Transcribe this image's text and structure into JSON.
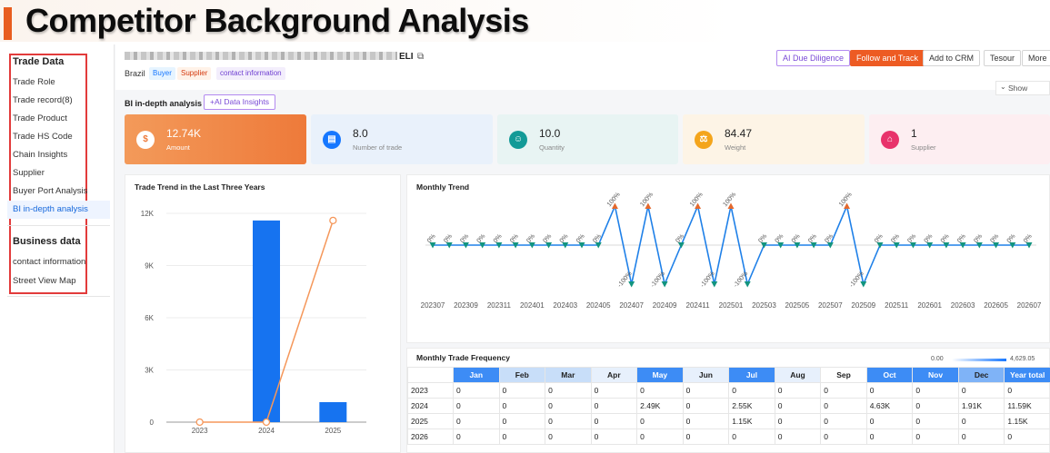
{
  "banner": {
    "title": "Competitor Background Analysis"
  },
  "sidebar": {
    "trade_section": "Trade Data",
    "trade_items": [
      "Trade Role",
      "Trade record(8)",
      "Trade Product",
      "Trade HS Code",
      "Chain Insights",
      "Supplier",
      "Buyer Port Analysis",
      "BI in-depth analysis"
    ],
    "business_section": "Business data",
    "business_items": [
      "contact information",
      "Street View Map"
    ]
  },
  "header": {
    "company_name": "ELI",
    "country": "Brazil",
    "tags": {
      "buyer": "Buyer",
      "supplier": "Supplier",
      "contact": "contact information"
    },
    "buttons": {
      "ai": "AI Due Diligence",
      "follow": "Follow and Track",
      "crm": "Add to CRM",
      "tesour": "Tesour",
      "more": "More"
    },
    "show": "Show"
  },
  "bi": {
    "label": "BI in-depth analysis",
    "insights_button": "+AI Data Insights"
  },
  "stats": [
    {
      "value": "12.74K",
      "label": "Amount",
      "icon": "dollar-icon"
    },
    {
      "value": "8.0",
      "label": "Number of trade",
      "icon": "clipboard-icon"
    },
    {
      "value": "10.0",
      "label": "Quantity",
      "icon": "person-icon"
    },
    {
      "value": "84.47",
      "label": "Weight",
      "icon": "scale-icon"
    },
    {
      "value": "1",
      "label": "Supplier",
      "icon": "store-icon"
    }
  ],
  "trend_panel": {
    "title": "Trade Trend in the Last Three Years"
  },
  "monthly_panel": {
    "title": "Monthly Trend"
  },
  "freq_panel": {
    "title": "Monthly Trade Frequency",
    "legend_min": "0.00",
    "legend_max": "4,629.05"
  },
  "chart_data": [
    {
      "type": "bar",
      "title": "Trade Trend in the Last Three Years",
      "categories": [
        "2023",
        "2024",
        "2025"
      ],
      "series": [
        {
          "type": "bar",
          "values": [
            0,
            11590,
            1150
          ],
          "color": "#1673f0"
        },
        {
          "type": "line",
          "values": [
            0,
            0,
            11590
          ],
          "color": "#f5975a"
        }
      ],
      "ylim": [
        0,
        12000
      ],
      "yticks": [
        0,
        3000,
        6000,
        9000,
        12000
      ],
      "ytick_labels": [
        "0",
        "3K",
        "6K",
        "9K",
        "12K"
      ],
      "grid": true
    },
    {
      "type": "line",
      "title": "Monthly Trend",
      "x": [
        "202307",
        "202308",
        "202309",
        "202310",
        "202311",
        "202312",
        "202401",
        "202402",
        "202403",
        "202404",
        "202405",
        "202406",
        "202407",
        "202408",
        "202409",
        "202410",
        "202411",
        "202412",
        "202501",
        "202502",
        "202503",
        "202504",
        "202505",
        "202506",
        "202507",
        "202508",
        "202509",
        "202510",
        "202511",
        "202512",
        "202601",
        "202602",
        "202603",
        "202604",
        "202605",
        "202606",
        "202607"
      ],
      "x_tick_labels": [
        "202307",
        "202309",
        "202311",
        "202401",
        "202403",
        "202405",
        "202407",
        "202409",
        "202411",
        "202501",
        "202503",
        "202505",
        "202507",
        "202509",
        "202511",
        "202601",
        "202603",
        "202605",
        "202607"
      ],
      "values": [
        0,
        0,
        0,
        0,
        0,
        0,
        0,
        0,
        0,
        0,
        0,
        100,
        -100,
        100,
        -100,
        0,
        100,
        -100,
        100,
        -100,
        0,
        0,
        0,
        0,
        0,
        100,
        -100,
        0,
        0,
        0,
        0,
        0,
        0,
        0,
        0,
        0,
        0
      ],
      "labels": [
        "0%",
        "0%",
        "0%",
        "0%",
        "0%",
        "0%",
        "0%",
        "0%",
        "0%",
        "0%",
        "0%",
        "100%",
        "-100%",
        "100%",
        "-100%",
        "0%",
        "100%",
        "-100%",
        "100%",
        "-100%",
        "0%",
        "0%",
        "0%",
        "0%",
        "0%",
        "100%",
        "-100%",
        "0%",
        "0%",
        "0%",
        "0%",
        "0%",
        "0%",
        "0%",
        "0%",
        "0%",
        "0%"
      ],
      "color": "#1f80e8",
      "up_color": "#e4692d",
      "down_color": "#12947f"
    },
    {
      "type": "table",
      "title": "Monthly Trade Frequency",
      "columns": [
        "",
        "Jan",
        "Feb",
        "Mar",
        "Apr",
        "May",
        "Jun",
        "Jul",
        "Aug",
        "Sep",
        "Oct",
        "Nov",
        "Dec",
        "Year total"
      ],
      "column_shades": [
        "",
        "dark",
        "light",
        "light",
        "pale",
        "dark",
        "pale",
        "dark",
        "pale",
        "",
        "dark",
        "dark",
        "mid",
        "dark"
      ],
      "rows": [
        [
          "2023",
          "0",
          "0",
          "0",
          "0",
          "0",
          "0",
          "0",
          "0",
          "0",
          "0",
          "0",
          "0",
          "0"
        ],
        [
          "2024",
          "0",
          "0",
          "0",
          "0",
          "2.49K",
          "0",
          "2.55K",
          "0",
          "0",
          "4.63K",
          "0",
          "1.91K",
          "11.59K"
        ],
        [
          "2025",
          "0",
          "0",
          "0",
          "0",
          "0",
          "0",
          "1.15K",
          "0",
          "0",
          "0",
          "0",
          "0",
          "1.15K"
        ],
        [
          "2026",
          "0",
          "0",
          "0",
          "0",
          "0",
          "0",
          "0",
          "0",
          "0",
          "0",
          "0",
          "0",
          "0"
        ]
      ]
    }
  ]
}
